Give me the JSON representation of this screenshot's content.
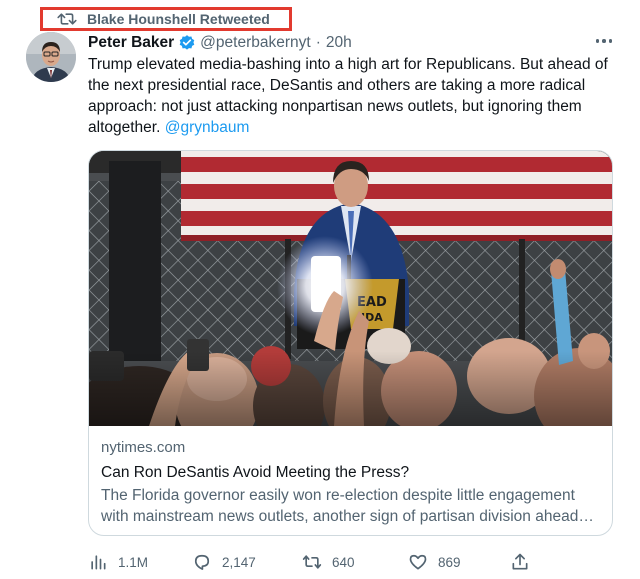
{
  "retweet": {
    "label": "Blake Hounshell Retweeted",
    "icon": "retweet-icon"
  },
  "author": {
    "name": "Peter Baker",
    "handle": "@peterbakernyt",
    "separator": "·",
    "time": "20h",
    "verified_icon": "verified-badge-icon",
    "verified_color": "#1d9bf0"
  },
  "tweet": {
    "text": "Trump elevated media-bashing into a high art for Republicans. But ahead of the next presidential race, DeSantis and others are taking a more radical approach: not just attacking nonpartisan news outlets, but ignoring them altogether.",
    "mention": "@grynbaum"
  },
  "card": {
    "domain": "nytimes.com",
    "title": "Can Ron DeSantis Avoid Meeting the Press?",
    "description": "The Florida governor easily won re-election despite little engagement with mainstream news outlets, another sign of partisan division ahead…",
    "image_icon": "article-photo"
  },
  "actions": {
    "views": {
      "icon": "analytics-icon",
      "count": "1.1M"
    },
    "replies": {
      "icon": "reply-icon",
      "count": "2,147"
    },
    "retweets": {
      "icon": "retweet-icon",
      "count": "640"
    },
    "likes": {
      "icon": "heart-icon",
      "count": "869"
    },
    "share": {
      "icon": "share-icon"
    }
  },
  "colors": {
    "accent": "#1d9bf0",
    "muted": "#536471",
    "highlight_box": "#e23a2f"
  }
}
